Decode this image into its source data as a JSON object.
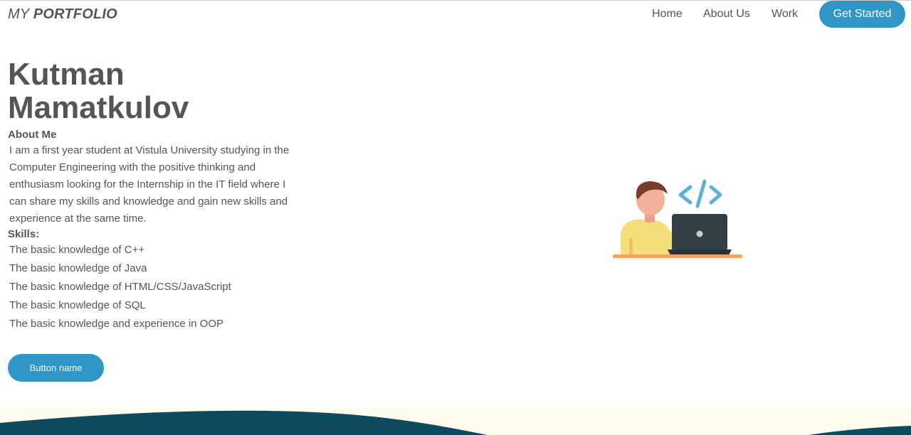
{
  "nav": {
    "logo_prefix": "MY",
    "logo_bold": "PORTFOLIO",
    "links": [
      "Home",
      "About Us",
      "Work"
    ],
    "cta_label": "Get Started"
  },
  "hero": {
    "name_line1": "Kutman",
    "name_line2": "Mamatkulov",
    "about_heading": "About Me",
    "about_text": "I am a first year student at Vistula University studying in the Computer Engineering with the positive thinking and enthusiasm looking for the Internship in the IT field where I can share my skills and knowledge and gain new skills and experience at the same time.",
    "skills_heading": "Skills:",
    "skills": [
      "The basic knowledge of C++",
      "The basic knowledge of Java",
      "The basic knowledge of HTML/CSS/JavaScript",
      "The basic knowledge of SQL",
      "The basic knowledge and experience in OOP"
    ],
    "button_label": "Button name"
  },
  "colors": {
    "accent": "#2f96c6",
    "text": "#555555",
    "footer_dark": "#0e4a5e",
    "footer_light": "#fffdf0"
  },
  "icons": {
    "illustration": "developer-at-laptop-illustration",
    "code": "code-brackets-icon"
  }
}
